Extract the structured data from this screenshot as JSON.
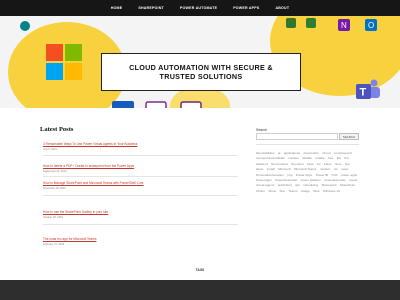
{
  "nav": {
    "items": [
      "HOME",
      "SHAREPOINT",
      "POWER AUTOMATE",
      "POWER APPS",
      "ABOUT"
    ]
  },
  "hero": {
    "title_line1": "CLOUD AUTOMATION WITH SECURE &",
    "title_line2": "TRUSTED SOLUTIONS",
    "icons": [
      "microsoft-logo-icon",
      "sharepoint-icon",
      "planner-icon",
      "excel-icon",
      "onenote-icon",
      "teams-icon",
      "outlook-icon",
      "word-icon",
      "visio-icon",
      "powerapps-icon"
    ]
  },
  "posts": {
    "heading": "Latest Posts",
    "items": [
      {
        "title": "4 Remarkable Ways To Use Power Virtual Agents In Your Business",
        "date": "July 6, 2021"
      },
      {
        "title": "How to delete a PDF / Cradle in sharepoint from the Power Apps",
        "date": "September 23, 2019"
      },
      {
        "title": "How to Manage SharePoint and Microsoft Teams with PowerShell Core",
        "date": "November 28, 2019"
      },
      {
        "title": "How to use the SharePoint Gallery in your site",
        "date": "October 18, 2019"
      },
      {
        "title": "The lunar leo app for Microsoft Teams",
        "date": "February 27, 2019"
      }
    ]
  },
  "sidebar": {
    "search_label": "Search",
    "search_placeholder": "",
    "search_button": "SEARCH",
    "tags": [
      "#sensabilities",
      "ai",
      "applications",
      "Automation",
      "Cloud",
      "computersoft",
      "connectmeworldwide",
      "cookies",
      "disable",
      "enable",
      "free",
      "fbo",
      "fbo-backend",
      "fbo-frontend",
      "fbo-client",
      "Flow",
      "Fs",
      "frame",
      "lines",
      "bus",
      "ideas",
      "install",
      "Microsoft",
      "Microsoft Teams",
      "modern",
      "ms",
      "news",
      "PersonalAutomation",
      "pnp",
      "Power Apps",
      "Power BI",
      "PVA",
      "power apps",
      "PowerApps",
      "PowerAutomate",
      "power platform",
      "powerautomate",
      "power virtual agents",
      "publishing",
      "site",
      "scheduling",
      "Sharepoint",
      "SharePoint Online",
      "Show",
      "Text",
      "Teams",
      "Usage",
      "Web",
      "Windows 10"
    ]
  },
  "footer": {
    "tags_heading": "TAGS"
  },
  "colors": {
    "nav_bg": "#161616",
    "link": "#c0392b",
    "footer_bg": "#2e2e2e",
    "blob_yellow": "#f7d23e"
  }
}
